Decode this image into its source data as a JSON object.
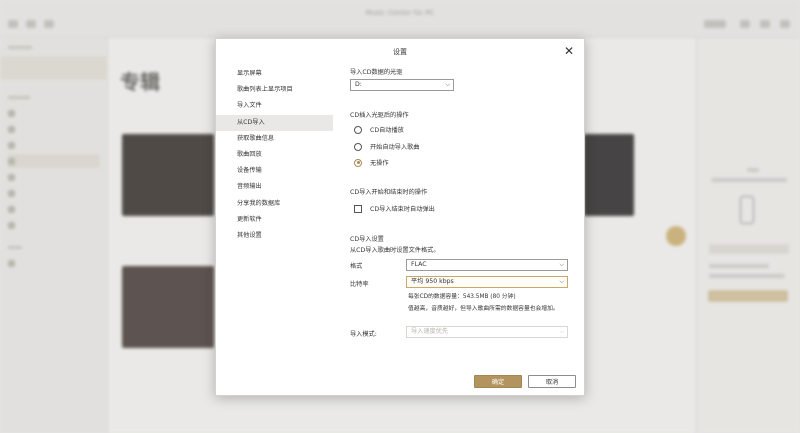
{
  "window": {
    "title": "Music Center for PC"
  },
  "background": {
    "page_title": "专辑"
  },
  "dialog": {
    "title": "设置",
    "nav": [
      "显示屏幕",
      "歌曲列表上显示项目",
      "导入文件",
      "从CD导入",
      "获取歌曲信息",
      "歌曲回放",
      "设备传输",
      "音频输出",
      "分享我的数据库",
      "更新软件",
      "其他设置"
    ],
    "active_nav_index": 3,
    "drive": {
      "label": "导入CD数据的光驱",
      "value": "D:"
    },
    "insert": {
      "label": "CD插入光驱后的操作",
      "options": [
        "CD自动播放",
        "开始自动导入歌曲",
        "无操作"
      ],
      "selected_index": 2
    },
    "after": {
      "label": "CD导入开始和结束时的操作",
      "checkbox_label": "CD导入结束时自动弹出",
      "checked": false
    },
    "import_settings": {
      "label": "CD导入设置",
      "description": "从CD导入歌曲时设置文件格式。",
      "format_label": "格式",
      "format_value": "FLAC",
      "bitrate_label": "比特率",
      "bitrate_value": "平均 950 kbps",
      "capacity_note": "每张CD的数据容量：543.5MB (80 分钟)",
      "quality_note": "值越高，音质越好，但导入歌曲所需的数据容量也会增加。",
      "mode_label": "导入模式:",
      "mode_value": "导入速度优先"
    },
    "ok_label": "确定",
    "cancel_label": "取消"
  },
  "colors": {
    "accent": "#b3945f",
    "active_nav_bg": "#e9e8e6"
  }
}
